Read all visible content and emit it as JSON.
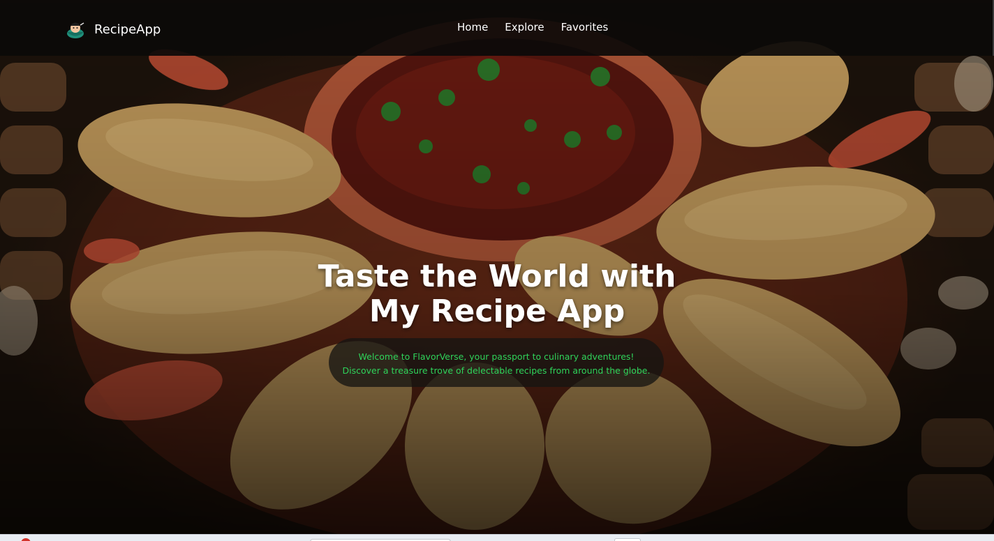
{
  "brand": {
    "name": "RecipeApp",
    "logo_icon": "chef-bowl-icon"
  },
  "nav": {
    "items": [
      {
        "label": "Home"
      },
      {
        "label": "Explore"
      },
      {
        "label": "Favorites"
      }
    ]
  },
  "hero": {
    "title_line1": "Taste the World with",
    "title_line2": "My Recipe App",
    "subtitle_line1": "Welcome to FlavorVerse, your passport to culinary adventures!",
    "subtitle_line2": "Discover a treasure trove of delectable recipes from around the globe.",
    "background_image": "fried-noodle-rolls-with-dipping-sauce"
  },
  "colors": {
    "navbar_bg": "#0c0a09",
    "nav_text": "#ffffff",
    "title_text": "#ffffff",
    "subtitle_text": "#2fd35a",
    "subtitle_pill_bg": "#161412"
  }
}
